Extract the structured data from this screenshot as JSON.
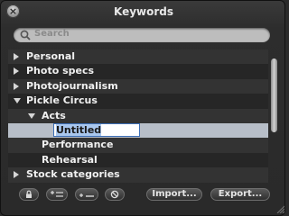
{
  "window": {
    "title": "Keywords"
  },
  "search": {
    "placeholder": "Search"
  },
  "keywords": {
    "rows": [
      {
        "label": "Personal",
        "disclosure": "collapsed",
        "level": 0
      },
      {
        "label": "Photo specs",
        "disclosure": "collapsed",
        "level": 0
      },
      {
        "label": "Photojournalism",
        "disclosure": "collapsed",
        "level": 0
      },
      {
        "label": "Pickle Circus",
        "disclosure": "expanded",
        "level": 0
      },
      {
        "label": "Acts",
        "disclosure": "expanded",
        "level": 1
      },
      {
        "label": "Untitled",
        "disclosure": "none",
        "level": 2,
        "editing": true
      },
      {
        "label": "Performance",
        "disclosure": "none",
        "level": 1
      },
      {
        "label": "Rehearsal",
        "disclosure": "none",
        "level": 1
      },
      {
        "label": "Stock categories",
        "disclosure": "collapsed",
        "level": 0
      }
    ]
  },
  "toolbar": {
    "lock_icon": "lock-icon",
    "add_keyword_icon": "add-keyword-icon",
    "add_subkeyword_icon": "add-subkeyword-icon",
    "remove_icon": "remove-keyword-icon",
    "import_label": "Import...",
    "export_label": "Export..."
  }
}
